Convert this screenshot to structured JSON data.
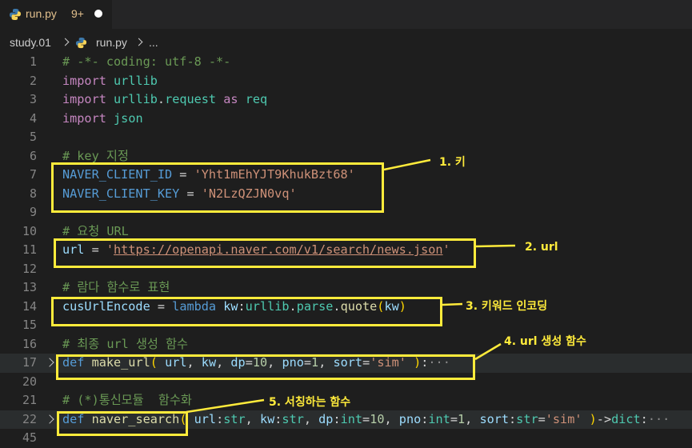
{
  "tab": {
    "filename": "run.py",
    "badge": "9+"
  },
  "breadcrumb": {
    "folder": "study.01",
    "file": "run.py",
    "more": "..."
  },
  "lines": [
    {
      "n": "1",
      "segs": [
        {
          "t": "# -*- coding: utf-8 -*-",
          "c": "com"
        }
      ]
    },
    {
      "n": "2",
      "segs": [
        {
          "t": "import",
          "c": "kw"
        },
        {
          "t": " "
        },
        {
          "t": "urllib",
          "c": "mod"
        }
      ]
    },
    {
      "n": "3",
      "segs": [
        {
          "t": "import",
          "c": "kw"
        },
        {
          "t": " "
        },
        {
          "t": "urllib",
          "c": "mod"
        },
        {
          "t": "."
        },
        {
          "t": "request",
          "c": "mod"
        },
        {
          "t": " "
        },
        {
          "t": "as",
          "c": "kw"
        },
        {
          "t": " "
        },
        {
          "t": "req",
          "c": "mod"
        }
      ]
    },
    {
      "n": "4",
      "segs": [
        {
          "t": "import",
          "c": "kw"
        },
        {
          "t": " "
        },
        {
          "t": "json",
          "c": "mod"
        }
      ]
    },
    {
      "n": "5",
      "segs": []
    },
    {
      "n": "6",
      "segs": [
        {
          "t": "# key 지정",
          "c": "com"
        }
      ]
    },
    {
      "n": "7",
      "segs": [
        {
          "t": "NAVER_CLIENT_ID",
          "c": "def"
        },
        {
          "t": " = "
        },
        {
          "t": "'Yht1mEhYJT9KhukBzt68'",
          "c": "str"
        }
      ]
    },
    {
      "n": "8",
      "segs": [
        {
          "t": "NAVER_CLIENT_KEY",
          "c": "def"
        },
        {
          "t": " = "
        },
        {
          "t": "'N2LzQZJN0vq'",
          "c": "str"
        }
      ]
    },
    {
      "n": "9",
      "segs": []
    },
    {
      "n": "10",
      "segs": [
        {
          "t": "# 요청 URL",
          "c": "com"
        }
      ]
    },
    {
      "n": "11",
      "segs": [
        {
          "t": "url",
          "c": "var"
        },
        {
          "t": " = "
        },
        {
          "t": "'",
          "c": "str"
        },
        {
          "t": "https://openapi.naver.com/v1/search/news.json",
          "c": "str link"
        },
        {
          "t": "'",
          "c": "str"
        }
      ]
    },
    {
      "n": "12",
      "segs": []
    },
    {
      "n": "13",
      "segs": [
        {
          "t": "# 람다 함수로 표현",
          "c": "com"
        }
      ]
    },
    {
      "n": "14",
      "segs": [
        {
          "t": "cusUrlEncode",
          "c": "var"
        },
        {
          "t": " = "
        },
        {
          "t": "lambda",
          "c": "def"
        },
        {
          "t": " "
        },
        {
          "t": "kw",
          "c": "var"
        },
        {
          "t": ":"
        },
        {
          "t": "urllib",
          "c": "mod"
        },
        {
          "t": "."
        },
        {
          "t": "parse",
          "c": "mod"
        },
        {
          "t": "."
        },
        {
          "t": "quote",
          "c": "fn"
        },
        {
          "t": "(",
          "c": "par"
        },
        {
          "t": "kw",
          "c": "var"
        },
        {
          "t": ")",
          "c": "par"
        }
      ]
    },
    {
      "n": "15",
      "segs": []
    },
    {
      "n": "16",
      "segs": [
        {
          "t": "# 최종 url 생성 함수",
          "c": "com"
        }
      ]
    },
    {
      "n": "17",
      "fold": true,
      "hl": true,
      "segs": [
        {
          "t": "def",
          "c": "def"
        },
        {
          "t": " "
        },
        {
          "t": "make_url",
          "c": "fn"
        },
        {
          "t": "(",
          "c": "par"
        },
        {
          "t": " "
        },
        {
          "t": "url",
          "c": "var"
        },
        {
          "t": ", "
        },
        {
          "t": "kw",
          "c": "var"
        },
        {
          "t": ", "
        },
        {
          "t": "dp",
          "c": "var"
        },
        {
          "t": "="
        },
        {
          "t": "10",
          "c": "num"
        },
        {
          "t": ", "
        },
        {
          "t": "pno",
          "c": "var"
        },
        {
          "t": "="
        },
        {
          "t": "1",
          "c": "num"
        },
        {
          "t": ", "
        },
        {
          "t": "sort",
          "c": "var"
        },
        {
          "t": "="
        },
        {
          "t": "'sim'",
          "c": "str"
        },
        {
          "t": " "
        },
        {
          "t": ")",
          "c": "par"
        },
        {
          "t": ":"
        },
        {
          "t": "···",
          "c": "ell"
        }
      ]
    },
    {
      "n": "20",
      "segs": []
    },
    {
      "n": "21",
      "segs": [
        {
          "t": "# (*)통신모듈  함수화",
          "c": "com"
        }
      ]
    },
    {
      "n": "22",
      "fold": true,
      "hl": true,
      "segs": [
        {
          "t": "def",
          "c": "def"
        },
        {
          "t": " "
        },
        {
          "t": "naver_search",
          "c": "fn"
        },
        {
          "t": "(",
          "c": "par"
        },
        {
          "t": " "
        },
        {
          "t": "url",
          "c": "var"
        },
        {
          "t": ":"
        },
        {
          "t": "str",
          "c": "mod"
        },
        {
          "t": ", "
        },
        {
          "t": "kw",
          "c": "var"
        },
        {
          "t": ":"
        },
        {
          "t": "str",
          "c": "mod"
        },
        {
          "t": ", "
        },
        {
          "t": "dp",
          "c": "var"
        },
        {
          "t": ":"
        },
        {
          "t": "int",
          "c": "mod"
        },
        {
          "t": "="
        },
        {
          "t": "10",
          "c": "num"
        },
        {
          "t": ", "
        },
        {
          "t": "pno",
          "c": "var"
        },
        {
          "t": ":"
        },
        {
          "t": "int",
          "c": "mod"
        },
        {
          "t": "="
        },
        {
          "t": "1",
          "c": "num"
        },
        {
          "t": ", "
        },
        {
          "t": "sort",
          "c": "var"
        },
        {
          "t": ":"
        },
        {
          "t": "str",
          "c": "mod"
        },
        {
          "t": "="
        },
        {
          "t": "'sim'",
          "c": "str"
        },
        {
          "t": " "
        },
        {
          "t": ")",
          "c": "par"
        },
        {
          "t": "->"
        },
        {
          "t": "dict",
          "c": "mod"
        },
        {
          "t": ":"
        },
        {
          "t": "···",
          "c": "ell"
        }
      ]
    },
    {
      "n": "45",
      "segs": []
    }
  ],
  "annotations": {
    "key": "1. 키",
    "url": "2. url",
    "encode": "3. 키워드 인코딩",
    "make_url": "4. url 생성 함수",
    "search": "5. 서칭하는 함수"
  },
  "colors": {
    "highlight": "#ffeb3b",
    "background": "#1e1e1e",
    "comment": "#6a9955"
  }
}
